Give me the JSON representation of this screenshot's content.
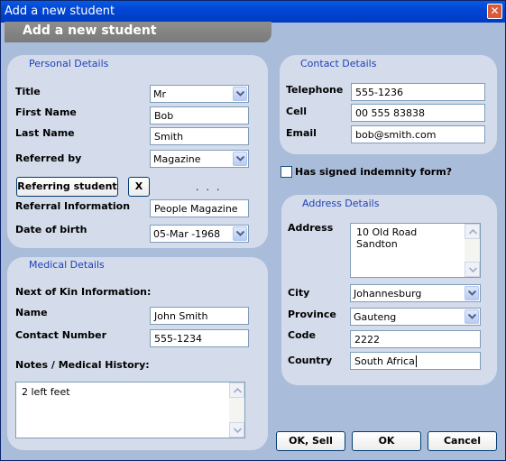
{
  "window": {
    "title": "Add a new student",
    "close_glyph": "✕"
  },
  "banner": {
    "text": "Add a new student"
  },
  "personal": {
    "title": "Personal Details",
    "title_label": "Title",
    "title_value": "Mr",
    "first_name_label": "First Name",
    "first_name_value": "Bob",
    "last_name_label": "Last Name",
    "last_name_value": "Smith",
    "referred_by_label": "Referred by",
    "referred_by_value": "Magazine",
    "referring_student_button": "Referring student",
    "clear_button": "X",
    "placeholder_dots": "...",
    "referral_info_label": "Referral Information",
    "referral_info_value": "People Magazine",
    "dob_label": "Date of birth",
    "dob_value": "05-Mar -1968"
  },
  "contact": {
    "title": "Contact Details",
    "telephone_label": "Telephone",
    "telephone_value": "555-1236",
    "cell_label": "Cell",
    "cell_value": "00 555 83838",
    "email_label": "Email",
    "email_value": "bob@smith.com"
  },
  "indemnity": {
    "label": "Has signed indemnity form?",
    "checked": false
  },
  "address": {
    "title": "Address Details",
    "address_label": "Address",
    "address_lines": [
      "10 Old Road",
      "Sandton"
    ],
    "city_label": "City",
    "city_value": "Johannesburg",
    "province_label": "Province",
    "province_value": "Gauteng",
    "code_label": "Code",
    "code_value": "2222",
    "country_label": "Country",
    "country_value": "South Africa"
  },
  "medical": {
    "title": "Medical Details",
    "next_of_kin_label": "Next of Kin Information:",
    "name_label": "Name",
    "name_value": "John Smith",
    "contact_number_label": "Contact Number",
    "contact_number_value": "555-1234",
    "notes_label": "Notes / Medical History:",
    "notes_lines": [
      "2 left feet"
    ]
  },
  "buttons": {
    "ok_sell": "OK, Sell",
    "ok": "OK",
    "cancel": "Cancel"
  },
  "colors": {
    "window_bg": "#a9bcd9",
    "panel_bg": "#d4dceb",
    "panel_title": "#1f3fb8",
    "titlebar": "#0046d5"
  }
}
